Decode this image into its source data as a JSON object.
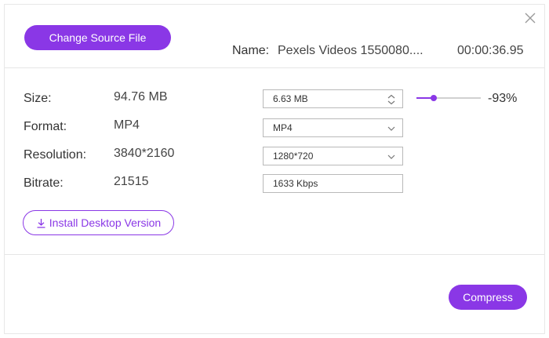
{
  "header": {
    "change_source_label": "Change Source File",
    "name_label": "Name:",
    "file_name": "Pexels Videos 1550080....",
    "duration": "00:00:36.95",
    "close_icon": "close-icon"
  },
  "rows": {
    "size": {
      "label": "Size:",
      "original": "94.76 MB",
      "target_value": "6.63  MB",
      "control_icon": "spinner-arrows-icon"
    },
    "format": {
      "label": "Format:",
      "original": "MP4",
      "target_value": "MP4",
      "control_icon": "chevron-down-icon"
    },
    "resolution": {
      "label": "Resolution:",
      "original": "3840*2160",
      "target_value": "1280*720",
      "control_icon": "chevron-down-icon"
    },
    "bitrate": {
      "label": "Bitrate:",
      "original": "21515",
      "target_value": "1633 Kbps"
    }
  },
  "size_slider": {
    "fraction": 0.07,
    "percent_label": "-93%"
  },
  "install_label": "Install Desktop Version",
  "compress_label": "Compress",
  "colors": {
    "accent": "#8a37e6",
    "border": "#b9b9b9",
    "divider": "#e6e6e6"
  }
}
